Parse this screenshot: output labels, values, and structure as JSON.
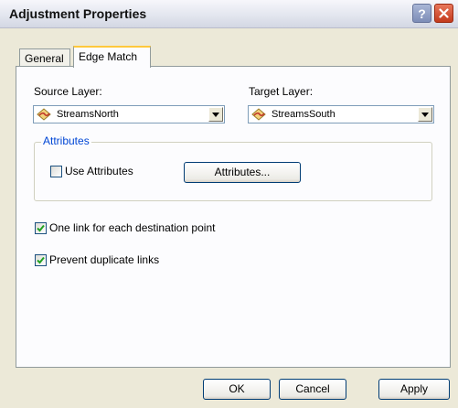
{
  "window": {
    "title": "Adjustment Properties"
  },
  "titlebar": {
    "help_icon": "question-mark-icon",
    "close_icon": "close-icon",
    "help_label": "?"
  },
  "tabs": [
    {
      "label": "General",
      "active": false
    },
    {
      "label": "Edge Match",
      "active": true
    }
  ],
  "source": {
    "label": "Source Layer:",
    "value": "StreamsNorth",
    "icon": "line-layer-icon"
  },
  "target": {
    "label": "Target Layer:",
    "value": "StreamsSouth",
    "icon": "line-layer-icon"
  },
  "attributes_group": {
    "legend": "Attributes",
    "use_attributes_label": "Use Attributes",
    "use_attributes_checked": false,
    "attributes_button": "Attributes..."
  },
  "options": {
    "one_link_label": "One link for each destination point",
    "one_link_checked": true,
    "prevent_duplicates_label": "Prevent duplicate links",
    "prevent_duplicates_checked": true
  },
  "buttons": {
    "ok": "OK",
    "cancel": "Cancel",
    "apply": "Apply"
  },
  "colors": {
    "legend_blue": "#0046d5",
    "tab_highlight": "#ffc83c",
    "check_green": "#21a121"
  }
}
